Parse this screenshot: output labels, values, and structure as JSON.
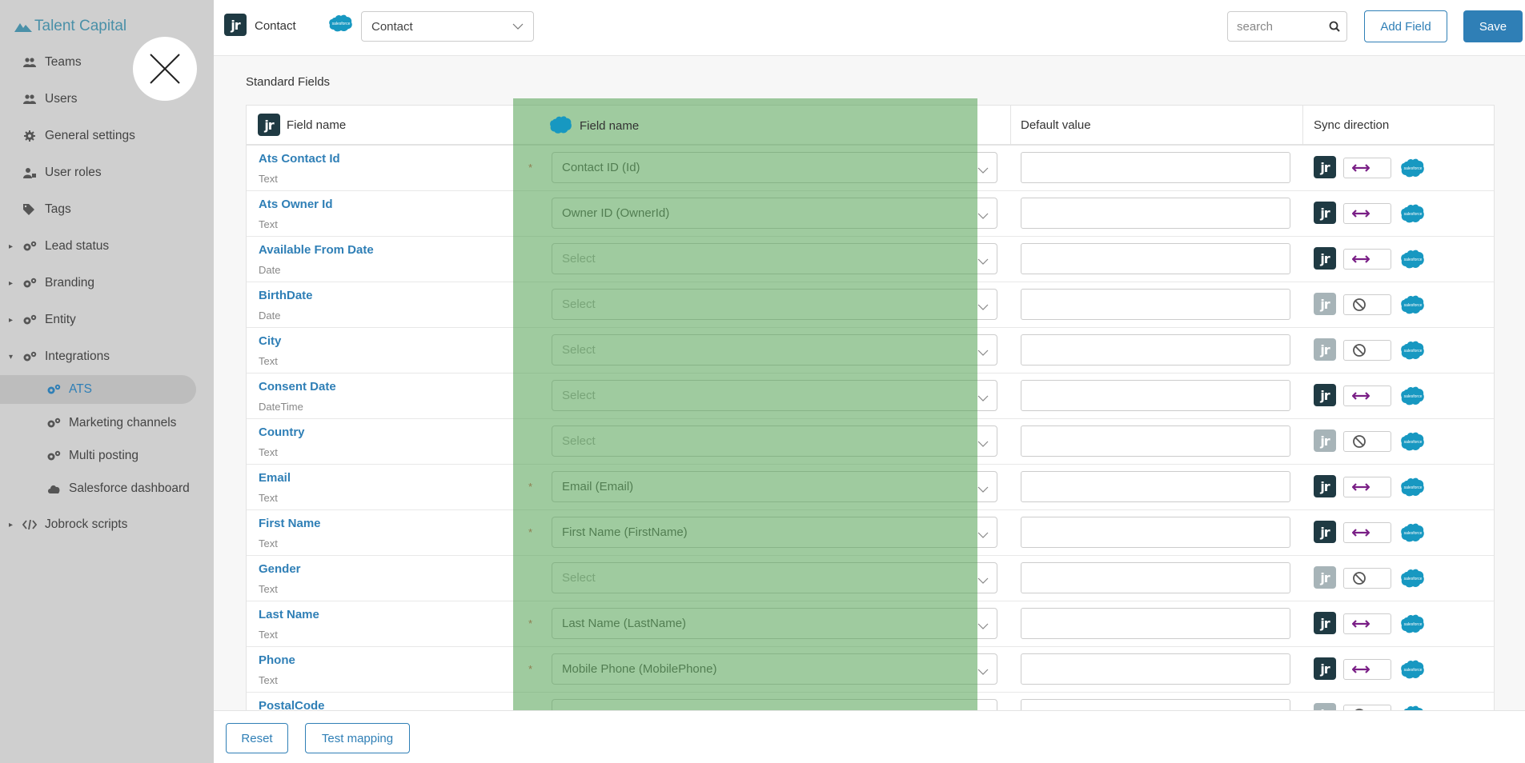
{
  "sidebar": {
    "brand": "Talent Capital",
    "items": [
      {
        "label": "Teams",
        "icon": "users-icon"
      },
      {
        "label": "Users",
        "icon": "users-icon"
      },
      {
        "label": "General settings",
        "icon": "gear-icon"
      },
      {
        "label": "User roles",
        "icon": "user-lock-icon"
      },
      {
        "label": "Tags",
        "icon": "tags-icon"
      },
      {
        "label": "Lead status",
        "icon": "gears-icon"
      },
      {
        "label": "Branding",
        "icon": "gears-icon"
      },
      {
        "label": "Entity",
        "icon": "gears-icon"
      },
      {
        "label": "Integrations",
        "icon": "gears-icon"
      },
      {
        "label": "ATS",
        "icon": "gears-icon"
      },
      {
        "label": "Marketing channels",
        "icon": "gears-icon"
      },
      {
        "label": "Multi posting",
        "icon": "gears-icon"
      },
      {
        "label": "Salesforce dashboard",
        "icon": "cloud-icon"
      },
      {
        "label": "Jobrock scripts",
        "icon": "code-icon"
      }
    ]
  },
  "header": {
    "jr_badge": "jr",
    "object_label": "Contact",
    "sf_label": "salesforce",
    "object_select_value": "Contact",
    "search_placeholder": "search",
    "add_field_label": "Add Field",
    "save_label": "Save"
  },
  "main": {
    "section_title": "Standard Fields",
    "columns": {
      "jr_field_name": "Field name",
      "sf_field_name": "Field name",
      "default_value": "Default value",
      "sync_direction": "Sync direction"
    },
    "rows": [
      {
        "name": "Ats Contact Id",
        "type": "Text",
        "required": "*",
        "mapping": "Contact ID (Id)",
        "sync": "bidirectional"
      },
      {
        "name": "Ats Owner Id",
        "type": "Text",
        "required": "",
        "mapping": "Owner ID (OwnerId)",
        "sync": "bidirectional"
      },
      {
        "name": "Available From Date",
        "type": "Date",
        "required": "",
        "mapping": "Select",
        "sync": "bidirectional"
      },
      {
        "name": "BirthDate",
        "type": "Date",
        "required": "",
        "mapping": "Select",
        "sync": "disabled"
      },
      {
        "name": "City",
        "type": "Text",
        "required": "",
        "mapping": "Select",
        "sync": "disabled"
      },
      {
        "name": "Consent Date",
        "type": "DateTime",
        "required": "",
        "mapping": "Select",
        "sync": "bidirectional"
      },
      {
        "name": "Country",
        "type": "Text",
        "required": "",
        "mapping": "Select",
        "sync": "disabled"
      },
      {
        "name": "Email",
        "type": "Text",
        "required": "*",
        "mapping": "Email (Email)",
        "sync": "bidirectional"
      },
      {
        "name": "First Name",
        "type": "Text",
        "required": "*",
        "mapping": "First Name (FirstName)",
        "sync": "bidirectional"
      },
      {
        "name": "Gender",
        "type": "Text",
        "required": "",
        "mapping": "Select",
        "sync": "disabled"
      },
      {
        "name": "Last Name",
        "type": "Text",
        "required": "*",
        "mapping": "Last Name (LastName)",
        "sync": "bidirectional"
      },
      {
        "name": "Phone",
        "type": "Text",
        "required": "*",
        "mapping": "Mobile Phone (MobilePhone)",
        "sync": "bidirectional"
      },
      {
        "name": "PostalCode",
        "type": "",
        "required": "",
        "mapping": "",
        "sync": "disabled"
      }
    ]
  },
  "footer": {
    "reset_label": "Reset",
    "test_mapping_label": "Test mapping"
  },
  "colors": {
    "accent": "#2f7fb6",
    "jr_badge": "#1f3a43",
    "sync_arrow": "#7a1f86",
    "salesforce": "#1798c1",
    "overlay": "#50a050"
  }
}
